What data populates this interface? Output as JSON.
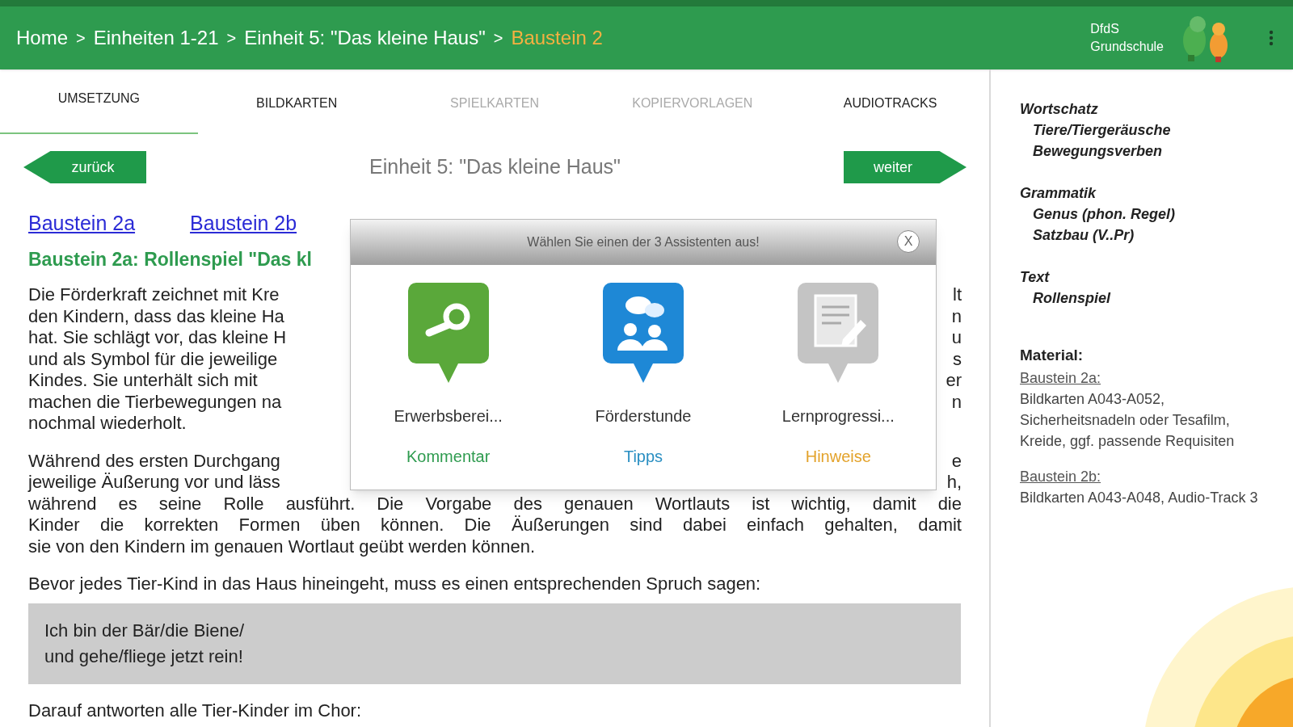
{
  "breadcrumb": [
    {
      "label": "Home",
      "current": false
    },
    {
      "label": "Einheiten 1-21",
      "current": false
    },
    {
      "label": "Einheit 5: \"Das kleine Haus\"",
      "current": false
    },
    {
      "label": "Baustein 2",
      "current": true
    }
  ],
  "breadcrumb_separator": ">",
  "logo": {
    "line1": "DfdS",
    "line2": "Grundschule"
  },
  "tabs": [
    {
      "label": "UMSETZUNG",
      "selected": true,
      "disabled": false
    },
    {
      "label": "BILDKARTEN",
      "selected": false,
      "disabled": false
    },
    {
      "label": "SPIELKARTEN",
      "selected": false,
      "disabled": true
    },
    {
      "label": "KOPIERVORLAGEN",
      "selected": false,
      "disabled": true
    },
    {
      "label": "AUDIOTRACKS",
      "selected": false,
      "disabled": false
    }
  ],
  "nav": {
    "back": "zurück",
    "title": "Einheit 5: \"Das kleine Haus\"",
    "next": "weiter"
  },
  "links": [
    "Baustein 2a",
    "Baustein 2b"
  ],
  "heading": "Baustein 2a: Rollenspiel \"Das kl",
  "paragraphs": [
    {
      "lines": [
        {
          "left": "Die Förderkraft zeichnet mit Kre",
          "right": "lt"
        },
        {
          "left": "den Kindern, dass das kleine Ha",
          "right": "n"
        },
        {
          "left": "hat. Sie schlägt vor, das kleine H",
          "right": "u"
        },
        {
          "left": "und als Symbol für die jeweilige",
          "right": "s"
        },
        {
          "left": "Kindes. Sie unterhält sich mit",
          "right": "er"
        },
        {
          "left": "machen die Tierbewegungen na",
          "right": "n"
        },
        {
          "left": "nochmal wiederholt."
        }
      ]
    },
    {
      "lines": [
        {
          "left": "Während des ersten Durchgang",
          "right": "e"
        },
        {
          "left": "jeweilige Äußerung vor und läss",
          "right": "h,"
        },
        {
          "left": "während es seine Rolle ausführt. Die Vorgabe des genauen Wortlauts ist wichtig, damit die"
        },
        {
          "left": "Kinder die korrekten Formen üben können. Die Äußerungen sind dabei einfach gehalten, damit"
        },
        {
          "left": "sie von den Kindern im genauen Wortlaut geübt werden können."
        }
      ]
    },
    {
      "lines": [
        {
          "left": "Bevor jedes Tier-Kind in das Haus hineingeht, muss es einen entsprechenden Spruch sagen:"
        }
      ]
    }
  ],
  "quote": [
    "Ich bin der Bär/die Biene/",
    "und gehe/fliege jetzt rein!"
  ],
  "after_quote": "Darauf antworten alle Tier-Kinder im Chor:",
  "dialog": {
    "title": "Wählen Sie einen der 3 Assistenten aus!",
    "close": "X",
    "items": [
      {
        "kind": "search",
        "title": "Erwerbsberei...",
        "subtitle": "Kommentar",
        "color": "#2e9b4f"
      },
      {
        "kind": "chat",
        "title": "Förderstunde",
        "subtitle": "Tipps",
        "color": "#2a8fc2"
      },
      {
        "kind": "document",
        "title": "Lernprogressi...",
        "subtitle": "Hinweise",
        "color": "#e3a22a"
      }
    ]
  },
  "sidebar": {
    "sections": [
      {
        "heading": "Wortschatz",
        "items": [
          "Tiere/Tiergeräusche",
          "Bewegungsverben"
        ]
      },
      {
        "heading": "Grammatik",
        "items": [
          "Genus (phon. Regel)",
          "Satzbau (V..Pr)"
        ]
      },
      {
        "heading": "Text",
        "items": [
          "Rollenspiel"
        ]
      }
    ],
    "material": {
      "heading": "Material:",
      "groups": [
        {
          "label": "Baustein 2a:",
          "text": "Bildkarten A043-A052, Sicherheitsnadeln oder Tesafilm, Kreide, ggf. passende Requisiten"
        },
        {
          "label": "Baustein 2b:",
          "text": "Bildkarten A043-A048, Audio-Track 3"
        }
      ]
    }
  }
}
